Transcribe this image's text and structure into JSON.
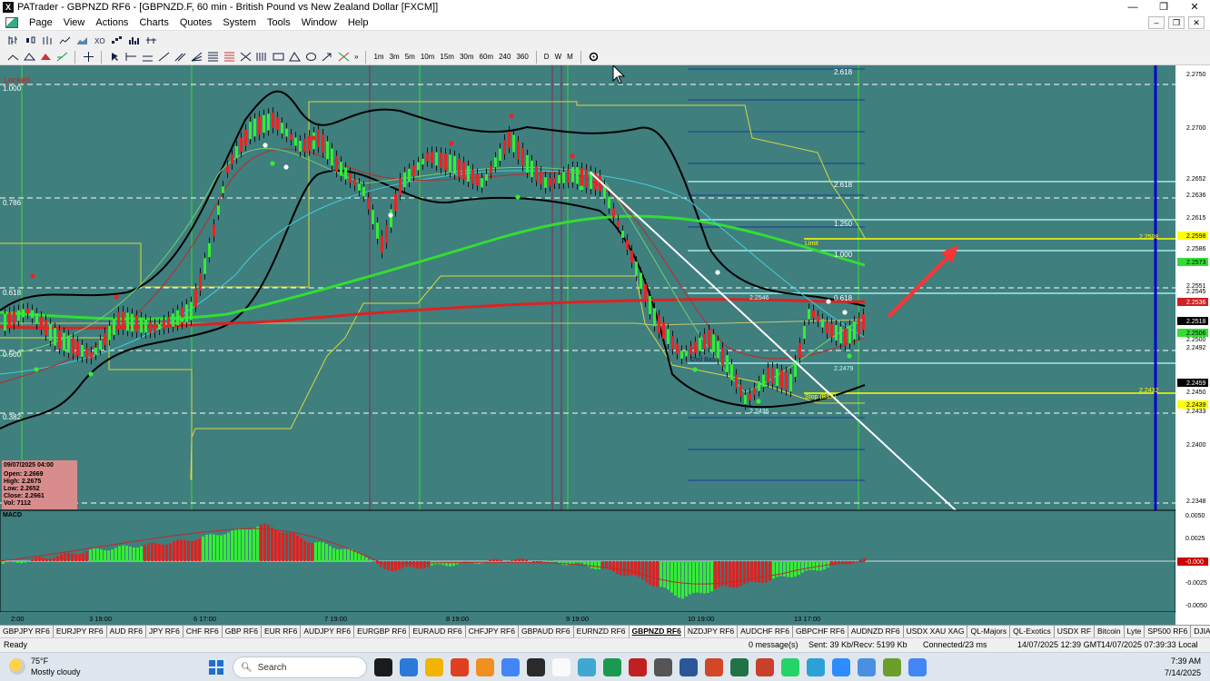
{
  "window": {
    "title": "PATrader - GBPNZD RF6 - [GBPNZD.F, 60 min - British Pound vs New Zealand Dollar [FXCM]]"
  },
  "menu": [
    "Page",
    "View",
    "Actions",
    "Charts",
    "Quotes",
    "System",
    "Tools",
    "Window",
    "Help"
  ],
  "timeframes": [
    "1m",
    "3m",
    "5m",
    "10m",
    "15m",
    "30m",
    "60m",
    "240",
    "360",
    "D",
    "W",
    "M"
  ],
  "chart": {
    "locked_label": "Locked",
    "fib_left": [
      "1.000",
      "0.786",
      "0.618",
      "0.500",
      "0.382"
    ],
    "fib_right": [
      "2.618",
      "2.618",
      "1.250",
      "1.000",
      "0.618"
    ],
    "level_labels": [
      "2.2546",
      "Limit",
      "2.2436",
      "Stop (B&F)",
      "Grid Base",
      "2.2479",
      "2.2508",
      "2.2432"
    ],
    "price_scale": [
      "2.2750",
      "2.2700",
      "2.2652",
      "2.2636",
      "2.2615",
      "2.2598",
      "2.2586",
      "2.2573",
      "2.2551",
      "2.2545",
      "2.2536",
      "2.2518",
      "2.2506",
      "2.2500",
      "2.2492",
      "2.2459",
      "2.2450",
      "2.2439",
      "2.2433",
      "2.2400",
      "2.2348"
    ],
    "ohlc_box": {
      "date": "09/07/2025 04:00",
      "open": "Open: 2.2669",
      "high": "High: 2.2675",
      "low": "Low: 2.2652",
      "close": "Close: 2.2661",
      "vol": "Vol: 7112"
    },
    "time_labels": [
      "2:00",
      "3 19:00",
      "6 17:00",
      "7 19:00",
      "8 19:00",
      "9 19:00",
      "10 19:00",
      "13 17:00"
    ],
    "macd_label": "MACD",
    "macd_scale": [
      "0.0050",
      "0.0025",
      "-0.000",
      "-0.0025",
      "-0.0050"
    ]
  },
  "tabs": [
    "GBPJPY RF6",
    "EURJPY RF6",
    "AUD RF6",
    "JPY RF6",
    "CHF RF6",
    "GBP RF6",
    "EUR RF6",
    "AUDJPY RF6",
    "EURGBP RF6",
    "EURAUD RF6",
    "CHFJPY RF6",
    "GBPAUD RF6",
    "EURNZD RF6",
    "GBPNZD RF6",
    "NZDJPY RF6",
    "AUDCHF RF6",
    "GBPCHF RF6",
    "AUDNZD RF6",
    "USDX XAU XAG",
    "QL-Majors",
    "QL-Exotics",
    "USDX RF",
    "Bitcoin",
    "Lyte",
    "SP500 RF6",
    "DJIA",
    "Ethirium"
  ],
  "active_tab": "GBPNZD RF6",
  "status": {
    "ready": "Ready",
    "messages": "0 message(s)",
    "traffic": "Sent: 39 Kb/Recv: 5199 Kb",
    "conn": "Connected/23 ms",
    "gmt": "14/07/2025 12:39 GMT",
    "local": "14/07/2025 07:39:33 Local"
  },
  "taskbar": {
    "temp": "75°F",
    "weather": "Mostly cloudy",
    "search": "Search",
    "time": "7:39 AM",
    "date": "7/14/2025"
  }
}
